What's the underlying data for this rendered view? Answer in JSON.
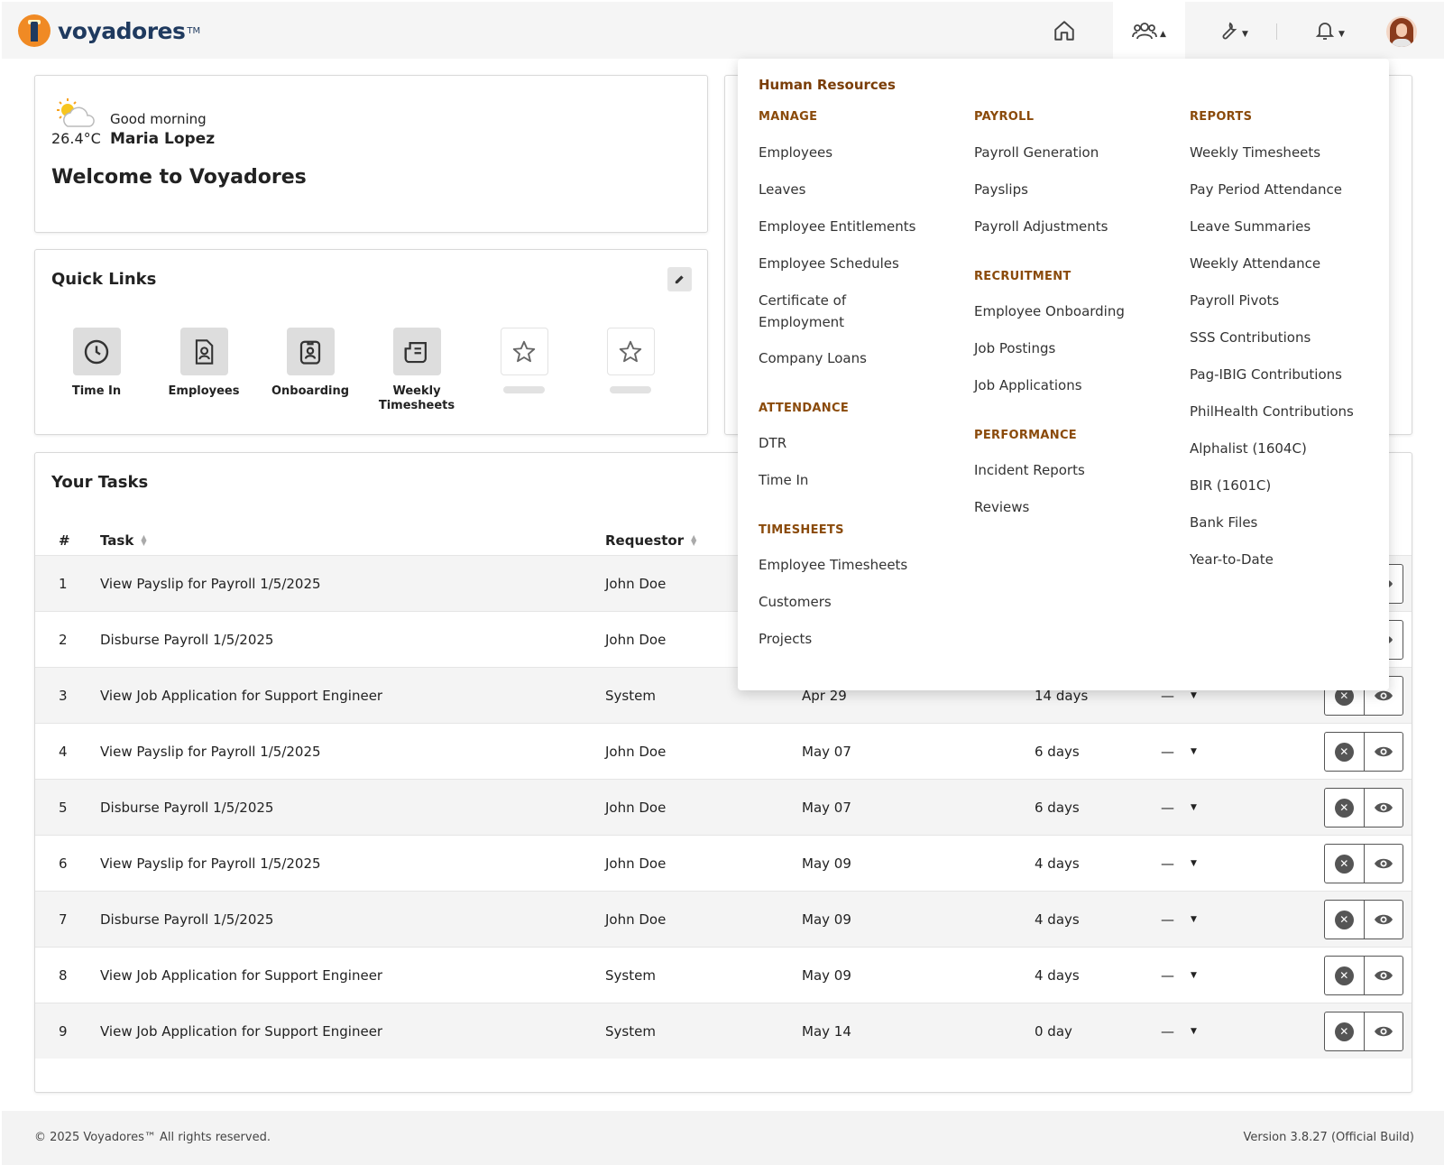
{
  "brand": {
    "name": "voyadores",
    "tm": "TM"
  },
  "nav": {
    "home_icon": "home-icon",
    "people_icon": "users-icon",
    "tools_icon": "wrench-icon",
    "bell_icon": "bell-icon"
  },
  "welcome": {
    "greeting": "Good morning",
    "temperature": "26.4°C",
    "user": "Maria Lopez",
    "title": "Welcome to Voyadores"
  },
  "quick_links": {
    "title": "Quick Links",
    "items": [
      {
        "label": "Time In",
        "icon": "clock-icon"
      },
      {
        "label": "Employees",
        "icon": "employee-file-icon"
      },
      {
        "label": "Onboarding",
        "icon": "badge-icon"
      },
      {
        "label": "Weekly Timesheets",
        "icon": "documents-icon"
      },
      {
        "label": "",
        "icon": "star-icon"
      },
      {
        "label": "",
        "icon": "star-icon"
      }
    ]
  },
  "tasks": {
    "title": "Your Tasks",
    "headers": {
      "num": "#",
      "task": "Task",
      "requestor": "Requestor"
    },
    "rows": [
      {
        "n": "1",
        "task": "View Payslip for Payroll 1/5/2025",
        "requestor": "John Doe",
        "date": "",
        "age": "",
        "status": ""
      },
      {
        "n": "2",
        "task": "Disburse Payroll 1/5/2025",
        "requestor": "John Doe",
        "date": "",
        "age": "",
        "status": ""
      },
      {
        "n": "3",
        "task": "View Job Application for Support Engineer",
        "requestor": "System",
        "date": "Apr 29",
        "age": "14 days",
        "status": "—"
      },
      {
        "n": "4",
        "task": "View Payslip for Payroll 1/5/2025",
        "requestor": "John Doe",
        "date": "May 07",
        "age": "6 days",
        "status": "—"
      },
      {
        "n": "5",
        "task": "Disburse Payroll 1/5/2025",
        "requestor": "John Doe",
        "date": "May 07",
        "age": "6 days",
        "status": "—"
      },
      {
        "n": "6",
        "task": "View Payslip for Payroll 1/5/2025",
        "requestor": "John Doe",
        "date": "May 09",
        "age": "4 days",
        "status": "—"
      },
      {
        "n": "7",
        "task": "Disburse Payroll 1/5/2025",
        "requestor": "John Doe",
        "date": "May 09",
        "age": "4 days",
        "status": "—"
      },
      {
        "n": "8",
        "task": "View Job Application for Support Engineer",
        "requestor": "System",
        "date": "May 09",
        "age": "4 days",
        "status": "—"
      },
      {
        "n": "9",
        "task": "View Job Application for Support Engineer",
        "requestor": "System",
        "date": "May 14",
        "age": "0 day",
        "status": "—"
      }
    ]
  },
  "menu": {
    "title": "Human Resources",
    "manage": {
      "label": "MANAGE",
      "items": [
        "Employees",
        "Leaves",
        "Employee Entitlements",
        "Employee Schedules",
        "Certificate of Employment",
        "Company Loans"
      ]
    },
    "attendance": {
      "label": "ATTENDANCE",
      "items": [
        "DTR",
        "Time In"
      ]
    },
    "timesheets": {
      "label": "TIMESHEETS",
      "items": [
        "Employee Timesheets",
        "Customers",
        "Projects"
      ]
    },
    "payroll": {
      "label": "PAYROLL",
      "items": [
        "Payroll Generation",
        "Payslips",
        "Payroll Adjustments"
      ]
    },
    "recruitment": {
      "label": "RECRUITMENT",
      "items": [
        "Employee Onboarding",
        "Job Postings",
        "Job Applications"
      ]
    },
    "performance": {
      "label": "PERFORMANCE",
      "items": [
        "Incident Reports",
        "Reviews"
      ]
    },
    "reports": {
      "label": "REPORTS",
      "items": [
        "Weekly Timesheets",
        "Pay Period Attendance",
        "Leave Summaries",
        "Weekly Attendance",
        "Payroll Pivots",
        "SSS Contributions",
        "Pag-IBIG Contributions",
        "PhilHealth Contributions",
        "Alphalist (1604C)",
        "BIR (1601C)",
        "Bank Files",
        "Year-to-Date"
      ]
    }
  },
  "footer": {
    "copyright": "© 2025 Voyadores™ All rights reserved.",
    "version": "Version 3.8.27 (Official Build)"
  }
}
